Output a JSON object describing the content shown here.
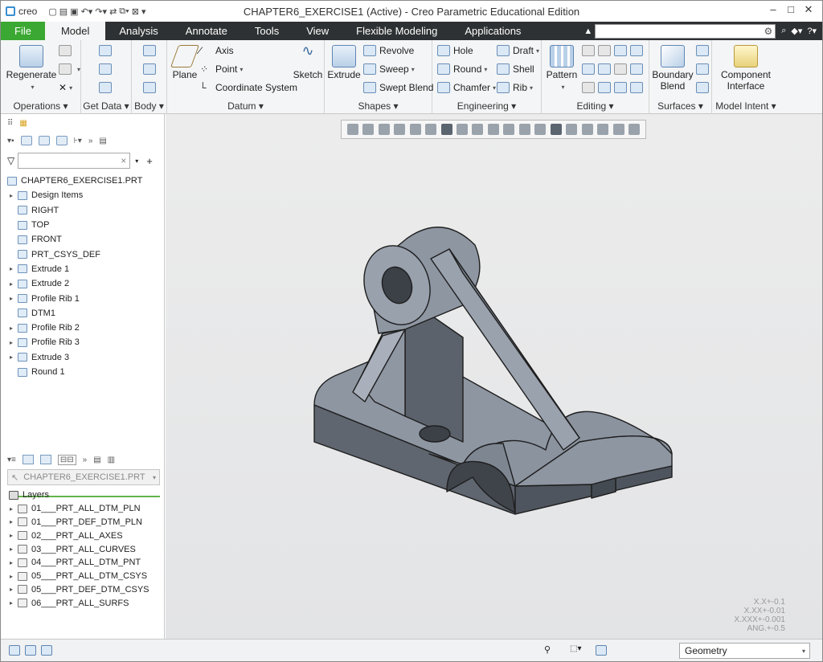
{
  "window": {
    "app_logo": "creo",
    "title": "CHAPTER6_EXERCISE1 (Active) - Creo Parametric Educational Edition",
    "controls": [
      "–",
      "□",
      "✕"
    ]
  },
  "tabs": [
    "File",
    "Model",
    "Analysis",
    "Annotate",
    "Tools",
    "View",
    "Flexible Modeling",
    "Applications"
  ],
  "ribbon": {
    "operations": {
      "label": "Operations",
      "regenerate": "Regenerate"
    },
    "get_data": {
      "label": "Get Data"
    },
    "body": {
      "label": "Body"
    },
    "datum": {
      "label": "Datum",
      "plane": "Plane",
      "axis": "Axis",
      "point": "Point",
      "csys": "Coordinate System",
      "sketch": "Sketch"
    },
    "shapes": {
      "label": "Shapes",
      "extrude": "Extrude",
      "revolve": "Revolve",
      "sweep": "Sweep",
      "swept_blend": "Swept Blend"
    },
    "engineering": {
      "label": "Engineering",
      "hole": "Hole",
      "round": "Round",
      "chamfer": "Chamfer",
      "draft": "Draft",
      "shell": "Shell",
      "rib": "Rib"
    },
    "editing": {
      "label": "Editing",
      "pattern": "Pattern"
    },
    "surfaces": {
      "label": "Surfaces",
      "boundary_blend": "Boundary Blend"
    },
    "model_intent": {
      "label": "Model Intent",
      "component_interface": "Component Interface"
    }
  },
  "model_tree": {
    "root": "CHAPTER6_EXERCISE1.PRT",
    "items": [
      {
        "label": "Design Items",
        "expandable": true
      },
      {
        "label": "RIGHT",
        "expandable": false
      },
      {
        "label": "TOP",
        "expandable": false
      },
      {
        "label": "FRONT",
        "expandable": false
      },
      {
        "label": "PRT_CSYS_DEF",
        "expandable": false
      },
      {
        "label": "Extrude 1",
        "expandable": true
      },
      {
        "label": "Extrude 2",
        "expandable": true
      },
      {
        "label": "Profile Rib 1",
        "expandable": true
      },
      {
        "label": "DTM1",
        "expandable": false
      },
      {
        "label": "Profile Rib 2",
        "expandable": true
      },
      {
        "label": "Profile Rib 3",
        "expandable": true
      },
      {
        "label": "Extrude 3",
        "expandable": true
      },
      {
        "label": "Round 1",
        "expandable": false
      }
    ]
  },
  "layer_tree": {
    "selector": "CHAPTER6_EXERCISE1.PRT",
    "root": "Layers",
    "items": [
      "01___PRT_ALL_DTM_PLN",
      "01___PRT_DEF_DTM_PLN",
      "02___PRT_ALL_AXES",
      "03___PRT_ALL_CURVES",
      "04___PRT_ALL_DTM_PNT",
      "05___PRT_ALL_DTM_CSYS",
      "05___PRT_DEF_DTM_CSYS",
      "06___PRT_ALL_SURFS"
    ]
  },
  "tolerances": [
    "X.X+-0.1",
    "X.XX+-0.01",
    "X.XXX+-0.001",
    "ANG.+-0.5"
  ],
  "status": {
    "filter": "Geometry"
  },
  "colors": {
    "tab_bar": "#2e3133",
    "file_tab": "#3aa832",
    "ribbon_bg": "#f4f5f6",
    "part_face": "#8e96a2",
    "tree_end_line": "#62b54a"
  }
}
